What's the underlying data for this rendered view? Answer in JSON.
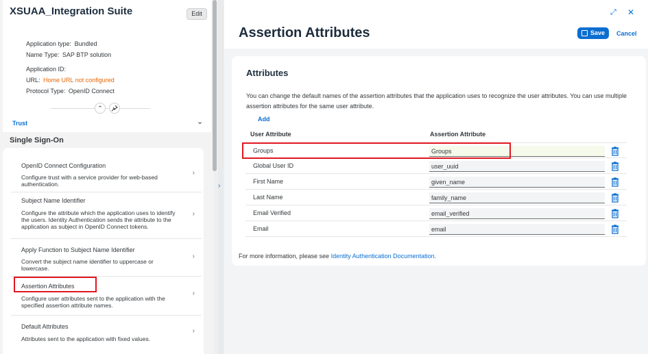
{
  "app": {
    "title": "XSUAA_Integration Suite",
    "edit_label": "Edit",
    "application_type_label": "Application type:",
    "application_type_value": "Bundled",
    "name_type_label": "Name Type:",
    "name_type_value": "SAP BTP solution",
    "application_id_label": "Application ID:",
    "url_label": "URL:",
    "url_value": "Home URL not configured",
    "protocol_type_label": "Protocol Type:",
    "protocol_type_value": "OpenID Connect"
  },
  "trust": {
    "label": "Trust"
  },
  "sso": {
    "title": "Single Sign-On",
    "items": [
      {
        "title": "OpenID Connect Configuration",
        "desc": "Configure trust with a service provider for web-based authentication."
      },
      {
        "title": "Subject Name Identifier",
        "desc": "Configure the attribute which the application uses to identify the users. Identity Authentication sends the attribute to the application as subject in OpenID Connect tokens."
      },
      {
        "title": "Apply Function to Subject Name Identifier",
        "desc": "Convert the subject name identifier to uppercase or lowercase."
      },
      {
        "title": "Assertion Attributes",
        "desc": "Configure user attributes sent to the application with the specified assertion attribute names."
      },
      {
        "title": "Default Attributes",
        "desc": "Attributes sent to the application with fixed values."
      }
    ]
  },
  "panel": {
    "title": "Assertion Attributes",
    "save_label": "Save",
    "cancel_label": "Cancel"
  },
  "attributes": {
    "title": "Attributes",
    "description": "You can change the default names of the assertion attributes that the application uses to recognize the user attributes. You can use multiple assertion attributes for the same user attribute.",
    "add_label": "Add",
    "col_user": "User Attribute",
    "col_assertion": "Assertion Attribute",
    "rows": [
      {
        "user": "Groups",
        "assertion": "Groups"
      },
      {
        "user": "Global User ID",
        "assertion": "user_uuid"
      },
      {
        "user": "First Name",
        "assertion": "given_name"
      },
      {
        "user": "Last Name",
        "assertion": "family_name"
      },
      {
        "user": "Email Verified",
        "assertion": "email_verified"
      },
      {
        "user": "Email",
        "assertion": "email"
      }
    ]
  },
  "footer": {
    "text": "For more information, please see ",
    "link": "Identity Authentication Documentation",
    "suffix": "."
  }
}
